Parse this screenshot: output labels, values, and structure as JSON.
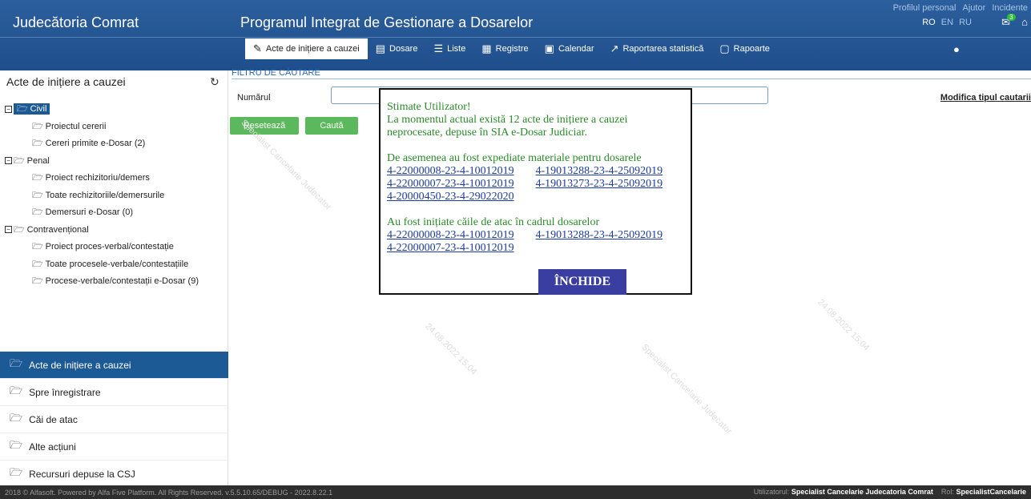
{
  "header": {
    "app_title": "Judecătoria Comrat",
    "program_title": "Programul Integrat de Gestionare a Dosarelor",
    "profile": "Profilul personal",
    "help": "Ajutor",
    "incidents": "Incidente",
    "langs": [
      "RO",
      "EN",
      "RU"
    ],
    "notif_count": "3"
  },
  "nav": {
    "tabs": [
      {
        "label": "Acte de inițiere a cauzei",
        "icon": "edit-doc-icon"
      },
      {
        "label": "Dosare",
        "icon": "folder-doc-icon"
      },
      {
        "label": "Liste",
        "icon": "list-icon"
      },
      {
        "label": "Registre",
        "icon": "registry-icon"
      },
      {
        "label": "Calendar",
        "icon": "calendar-icon"
      },
      {
        "label": "Raportarea statistică",
        "icon": "chart-icon"
      },
      {
        "label": "Rapoarte",
        "icon": "report-icon"
      }
    ]
  },
  "sidebar": {
    "title": "Acte de inițiere a cauzei",
    "tree": {
      "civil": {
        "label": "Civil",
        "items": [
          "Proiectul cererii",
          "Cereri primite e-Dosar (2)"
        ]
      },
      "penal": {
        "label": "Penal",
        "items": [
          "Proiect rechizitoriu/demers",
          "Toate rechizitoriile/demersurile",
          "Demersuri e-Dosar (0)"
        ]
      },
      "contra": {
        "label": "Contravențional",
        "items": [
          "Proiect proces-verbal/contestație",
          "Toate procesele-verbale/contestațiile",
          "Procese-verbale/contestații e-Dosar (9)"
        ]
      }
    },
    "nav": [
      "Acte de inițiere a cauzei",
      "Spre înregistrare",
      "Căi de atac",
      "Alte acțiuni",
      "Recursuri depuse la CSJ"
    ]
  },
  "filter": {
    "title": "FILTRU DE CĂUTARE",
    "number_label": "Numărul",
    "number_value": "",
    "modify": "Modifica tipul cautarii",
    "reset": "Resetează",
    "search": "Caută"
  },
  "watermark": {
    "text1": "Specialist Cancelarie Judecator",
    "text2": "24.08.2022 15:04"
  },
  "modal": {
    "greeting": "Stimate Utilizator!",
    "line1": "La momentul actual există 12 acte de inițiere a cauzei",
    "line2": "neprocesate, depuse în SIA e-Dosar Judiciar.",
    "line3": "De asemenea au fost expediate materiale pentru dosarele",
    "sent_links": [
      "4-22000008-23-4-10012019",
      "4-19013288-23-4-25092019",
      "4-22000007-23-4-10012019",
      "4-19013273-23-4-25092019",
      "4-20000450-23-4-29022020"
    ],
    "line4": "Au fost inițiate căile de atac în cadrul dosarelor",
    "appeal_links": [
      "4-22000008-23-4-10012019",
      "4-19013288-23-4-25092019",
      "4-22000007-23-4-10012019"
    ],
    "close": "ÎNCHIDE"
  },
  "footer": {
    "copyright": "2018 © Alfasoft. Powered by Alfa Five Platform. All Rights Reserved. v.5.5.10.65/DEBUG - 2022.8.22.1",
    "user_label": "Utilizatorul:",
    "user_value": "Specialist Cancelarie Judecatoria Comrat",
    "role_label": "Rol:",
    "role_value": "SpecialistCancelarie"
  }
}
